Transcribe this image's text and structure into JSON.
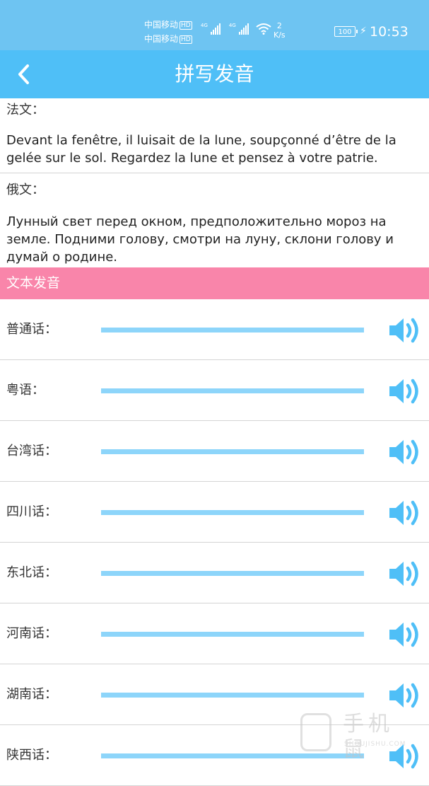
{
  "status_bar": {
    "carrier_1": "中国移动",
    "carrier_2": "中国移动",
    "hd_badge": "HD",
    "signal_tag": "4G",
    "net_speed_value": "2",
    "net_speed_unit": "K/s",
    "battery": "100",
    "time": "10:53"
  },
  "header": {
    "title": "拼写发音",
    "back_icon": "chevron-left-icon"
  },
  "translations": [
    {
      "label": "法文：",
      "text": "Devant la fenêtre, il luisait de la lune, soupçonné d’être de la gelée sur le sol. Regardez la lune et pensez à votre patrie."
    },
    {
      "label": "俄文：",
      "text": "Лунный свет перед окном, предположительно мороз на земле. Подними голову, смотри на луну, склони голову и думай о родине."
    }
  ],
  "section_title": "文本发音",
  "dialects": [
    {
      "label": "普通话："
    },
    {
      "label": "粤语："
    },
    {
      "label": "台湾话："
    },
    {
      "label": "四川话："
    },
    {
      "label": "东北话："
    },
    {
      "label": "河南话："
    },
    {
      "label": "湖南话："
    },
    {
      "label": "陕西话："
    }
  ],
  "speaker_icon": "speaker-icon",
  "watermark": {
    "title": "手机鼠",
    "subtitle": "SHOUJISHU.COM"
  },
  "colors": {
    "status_bar": "#6ec4f2",
    "title_bar": "#4fbff7",
    "section_header": "#f985aa",
    "slider": "#8dd5fa",
    "speaker": "#4fbff7"
  }
}
